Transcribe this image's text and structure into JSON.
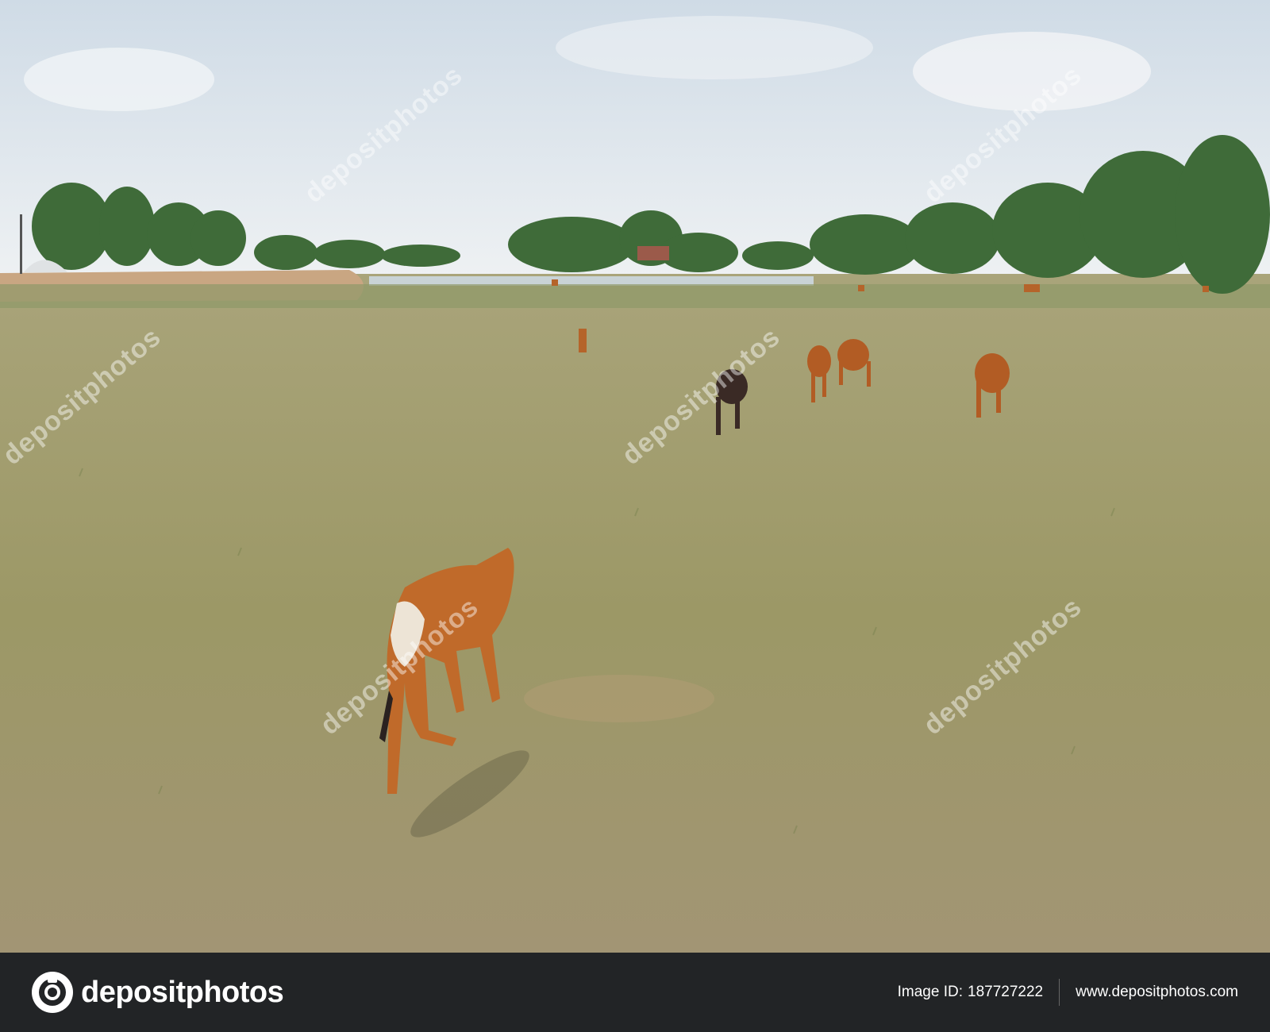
{
  "photo": {
    "subject": "cattle walking across dry field",
    "watermark_text": "depositphotos"
  },
  "footer": {
    "logo_text": "depositphotos",
    "image_id_label": "Image ID:",
    "image_id": "187727222",
    "website": "www.depositphotos.com"
  },
  "colors": {
    "sky": "#e9eef3",
    "field": "#9e9a6c",
    "cattle": "#c06a2a",
    "footer_bg": "#222426"
  },
  "icons": [
    "camera-logo-icon"
  ]
}
